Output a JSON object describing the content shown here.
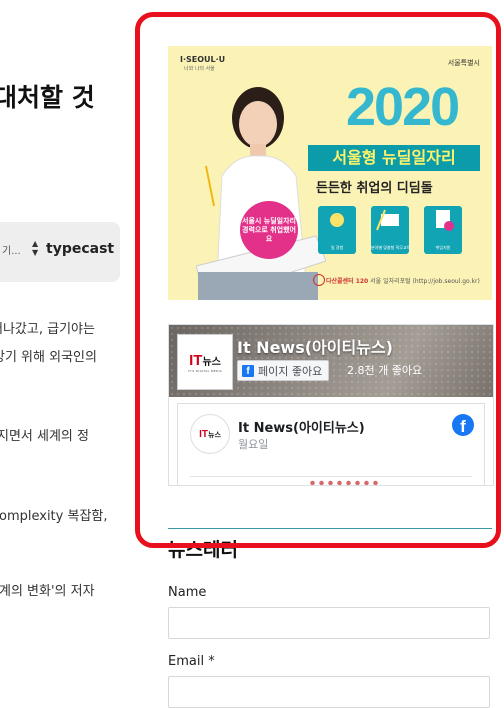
{
  "article": {
    "title_fragment": "대처할 것",
    "tts": {
      "dots": "기...",
      "logo": "typecast"
    },
    "lines": [
      "떠나갔고, 급기야는",
      "앙기 위해 외국인의",
      "지면서 세계의 정",
      "omplexity 복잡함,",
      "계의 변화'의 저자"
    ]
  },
  "banner": {
    "logo_left": "I·SEOUL·U",
    "logo_left_sub": "너와 나의 서울",
    "logo_right": "서울특별시",
    "year": "2020",
    "headline": "서울형 뉴딜일자리",
    "subheadline": "든든한 취업의 디딤돌",
    "badge": "서울시 뉴딜일자리 경력으로 취업했어요",
    "services": [
      "일 경험",
      "분야별 맞춤형 직무교육",
      "취업지원"
    ],
    "contact_prefix": "다산콜센터 120",
    "contact_suffix": "서울 일자리포털 (http://job.seoul.go.kr)"
  },
  "facebook": {
    "page_name": "It News(아이티뉴스)",
    "like_button": "페이지 좋아요",
    "like_count": "2.8천 개 좋아요",
    "logo_it": "IT",
    "logo_news": "뉴스",
    "logo_sub": "IT'S DIGITAL MEDIA",
    "post_author": "It News(아이티뉴스)",
    "post_date": "월요일"
  },
  "newsletter": {
    "title": "뉴스레터",
    "name_label": "Name",
    "name_value": "",
    "email_label": "Email *",
    "email_value": ""
  },
  "colors": {
    "highlight": "#e8101c",
    "accent": "#0c9ba9",
    "facebook": "#1877f2"
  }
}
